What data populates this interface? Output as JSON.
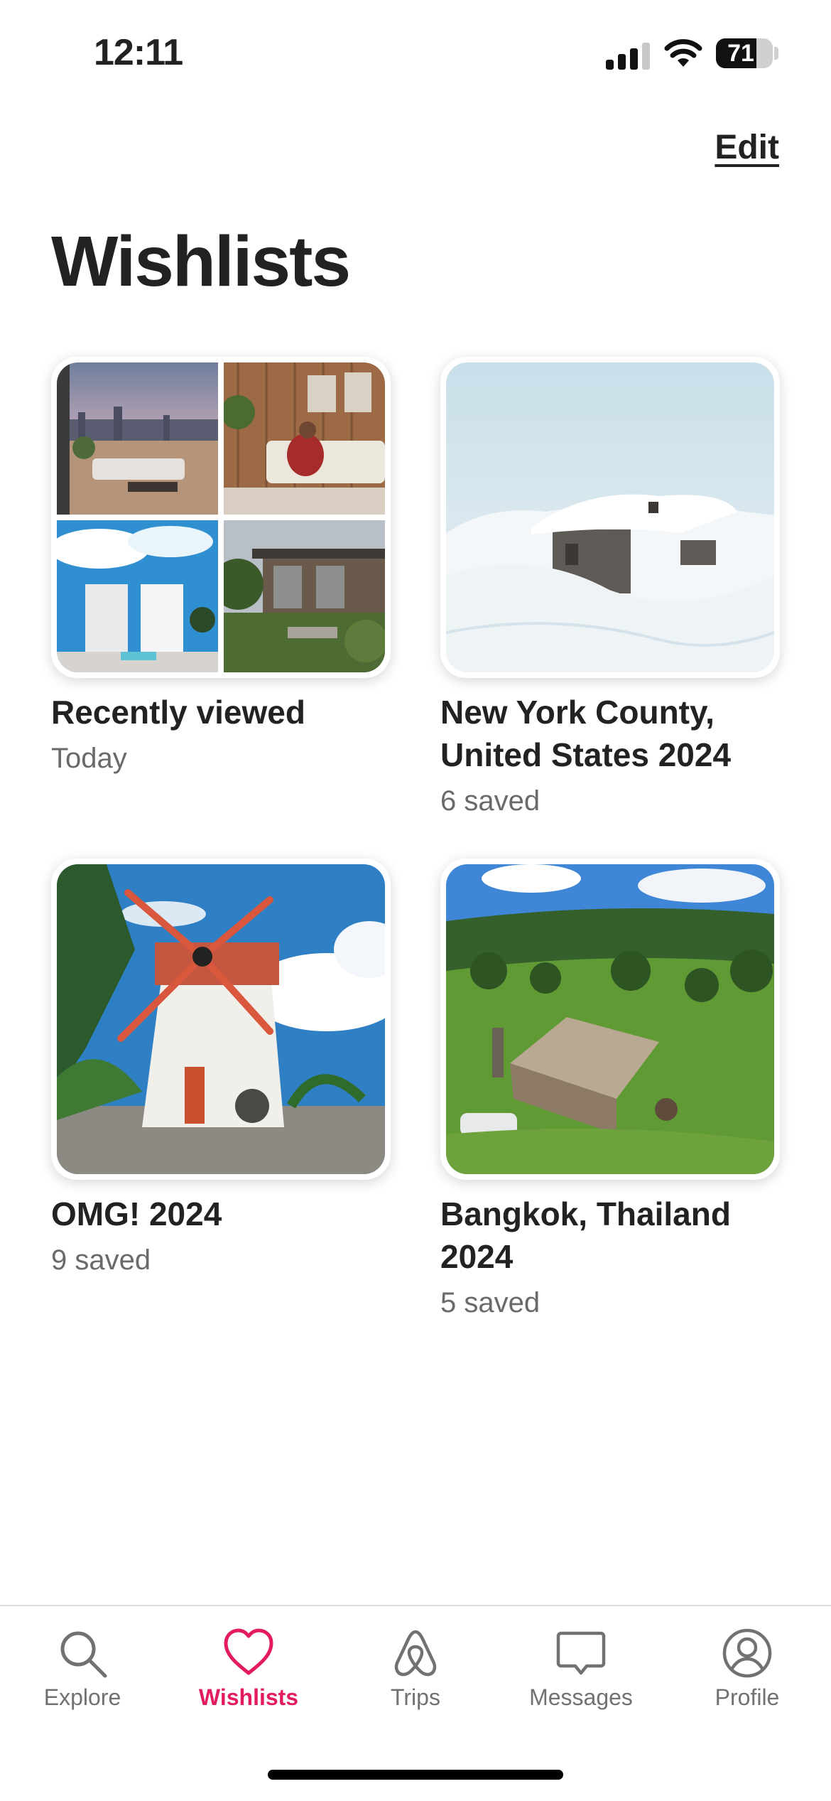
{
  "status_bar": {
    "time": "12:11",
    "battery": "71",
    "battery_level": 0.71
  },
  "header": {
    "edit_label": "Edit",
    "title": "Wishlists"
  },
  "wishlists": [
    {
      "title": "Recently viewed",
      "subtitle": "Today"
    },
    {
      "title": "New York County, United States 2024",
      "subtitle": "6 saved"
    },
    {
      "title": "OMG! 2024",
      "subtitle": "9 saved"
    },
    {
      "title": "Bangkok, Thailand 2024",
      "subtitle": "5 saved"
    }
  ],
  "tab_bar": {
    "tabs": [
      {
        "label": "Explore",
        "icon": "search-icon"
      },
      {
        "label": "Wishlists",
        "icon": "heart-icon",
        "active": true
      },
      {
        "label": "Trips",
        "icon": "airbnb-logo-icon"
      },
      {
        "label": "Messages",
        "icon": "message-icon"
      },
      {
        "label": "Profile",
        "icon": "profile-icon"
      }
    ]
  },
  "colors": {
    "accent": "#E31C5F",
    "text": "#222222",
    "muted": "#6a6a6a",
    "tab_inactive": "#717171"
  }
}
